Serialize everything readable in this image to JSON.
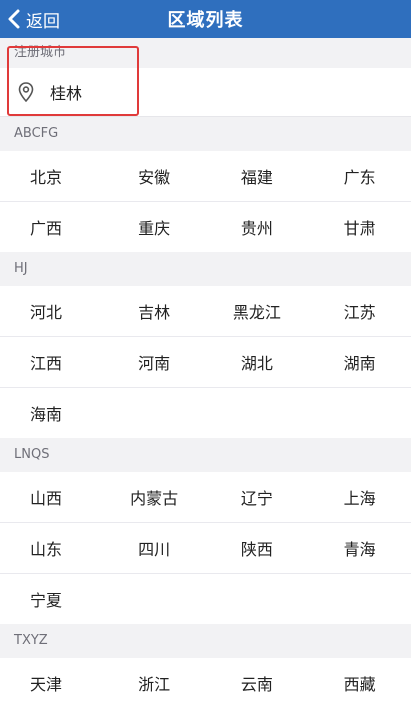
{
  "nav": {
    "back_label": "返回",
    "title": "区域列表"
  },
  "registered": {
    "header": "注册城市",
    "city": "桂林"
  },
  "sections": [
    {
      "header": "ABCFG",
      "rows": [
        [
          "北京",
          "安徽",
          "福建",
          "广东"
        ],
        [
          "广西",
          "重庆",
          "贵州",
          "甘肃"
        ]
      ]
    },
    {
      "header": "HJ",
      "rows": [
        [
          "河北",
          "吉林",
          "黑龙江",
          "江苏"
        ],
        [
          "江西",
          "河南",
          "湖北",
          "湖南"
        ],
        [
          "海南"
        ]
      ]
    },
    {
      "header": "LNQS",
      "rows": [
        [
          "山西",
          "内蒙古",
          "辽宁",
          "上海"
        ],
        [
          "山东",
          "四川",
          "陕西",
          "青海"
        ],
        [
          "宁夏"
        ]
      ]
    },
    {
      "header": "TXYZ",
      "rows": [
        [
          "天津",
          "浙江",
          "云南",
          "西藏"
        ]
      ]
    }
  ],
  "colors": {
    "navbar": "#2f6fbe",
    "highlight_border": "#e03a3a"
  }
}
